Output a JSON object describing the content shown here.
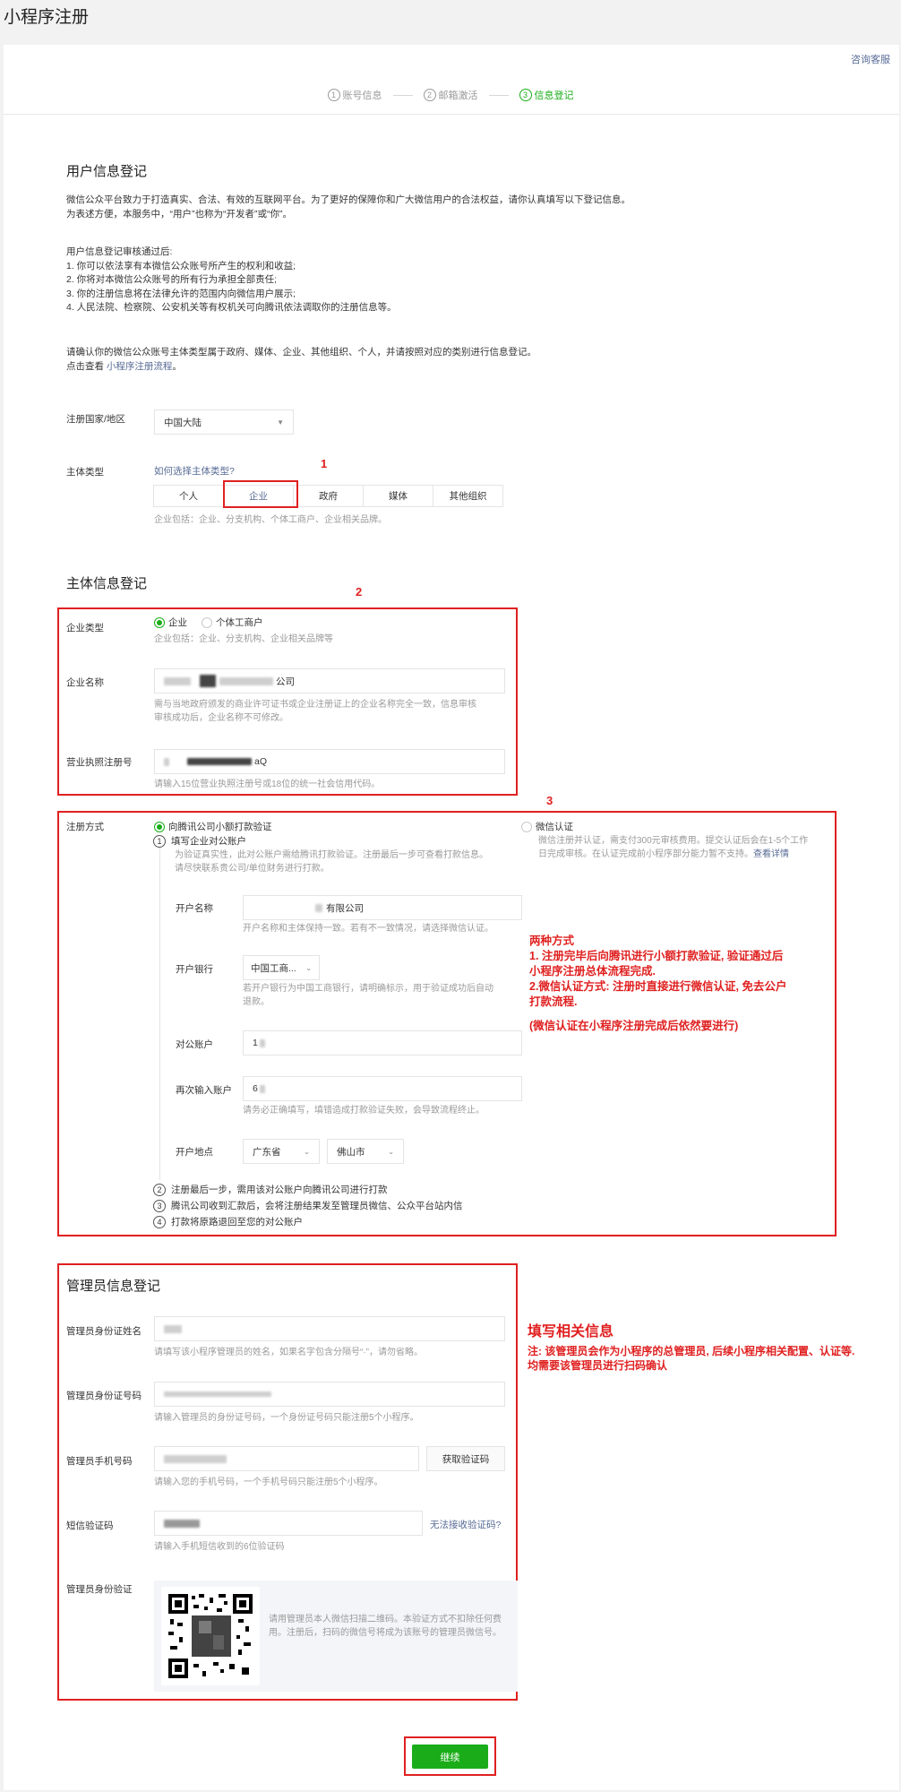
{
  "page": {
    "title": "小程序注册",
    "help": "咨询客服"
  },
  "steps": [
    {
      "num": "1",
      "label": "账号信息"
    },
    {
      "num": "2",
      "label": "邮箱激活"
    },
    {
      "num": "3",
      "label": "信息登记"
    }
  ],
  "user_info": {
    "title": "用户信息登记",
    "intro1": "微信公众平台致力于打造真实、合法、有效的互联网平台。为了更好的保障你和广大微信用户的合法权益，请你认真填写以下登记信息。",
    "intro2": "为表述方便，本服务中，“用户”也称为“开发者”或“你”。",
    "list_head": "用户信息登记审核通过后:",
    "list": [
      "1. 你可以依法享有本微信公众账号所产生的权利和收益;",
      "2. 你将对本微信公众账号的所有行为承担全部责任;",
      "3. 你的注册信息将在法律允许的范围内向微信用户展示;",
      "4. 人民法院、检察院、公安机关等有权机关可向腾讯依法调取你的注册信息等。"
    ],
    "confirm": "请确认你的微信公众账号主体类型属于政府、媒体、企业、其他组织、个人，并请按照对应的类别进行信息登记。",
    "view_prefix": "点击查看",
    "view_link": "小程序注册流程",
    "view_suffix": "。",
    "region_label": "注册国家/地区",
    "region_value": "中国大陆",
    "subject_label": "主体类型",
    "subject_help": "如何选择主体类型?",
    "subject_types": [
      "个人",
      "企业",
      "政府",
      "媒体",
      "其他组织"
    ],
    "subject_hint": "企业包括：企业、分支机构、个体工商户、企业相关品牌。"
  },
  "entity": {
    "title": "主体信息登记",
    "type_label": "企业类型",
    "type_options": [
      "企业",
      "个体工商户"
    ],
    "type_hint": "企业包括：企业、分支机构、企业相关品牌等",
    "name_label": "企业名称",
    "name_value": "公司",
    "name_hint1": "需与当地政府颁发的商业许可证书或企业注册证上的企业名称完全一致，信息审核",
    "name_hint2": "审核成功后，企业名称不可修改。",
    "license_label": "营业执照注册号",
    "license_value": "aQ",
    "license_hint": "请输入15位营业执照注册号或18位的统一社会信用代码。"
  },
  "register": {
    "label": "注册方式",
    "opt1": "向腾讯公司小额打款验证",
    "opt2": "微信认证",
    "opt2_hint1": "微信注册并认证，需支付300元审核费用。提交认证后会在1-5个工作",
    "opt2_hint2": "日完成审核。在认证完成前小程序部分能力暂不支持。",
    "opt2_link": "查看详情",
    "step1": "填写企业对公账户",
    "step1_hint1": "为验证真实性，此对公账户需给腾讯打款验证。注册最后一步可查看打款信息。",
    "step1_hint2": "请尽快联系贵公司/单位财务进行打款。",
    "acct_name_label": "开户名称",
    "acct_name_value": "有限公司",
    "acct_name_hint": "开户名称和主体保持一致。若有不一致情况，请选择微信认证。",
    "bank_label": "开户银行",
    "bank_value": "中国工商...",
    "bank_hint1": "若开户银行为中国工商银行，请明确标示，用于验证成功后自动",
    "bank_hint2": "退款。",
    "account_label": "对公账户",
    "account_value": "1",
    "account2_label": "再次输入账户",
    "account2_value": "6",
    "account_hint": "请务必正确填写，填错造成打款验证失败，会导致流程终止。",
    "location_label": "开户地点",
    "province": "广东省",
    "city": "佛山市",
    "steps_after": [
      {
        "num": "2",
        "text": "注册最后一步，需用该对公账户向腾讯公司进行打款"
      },
      {
        "num": "3",
        "text": "腾讯公司收到汇款后，会将注册结果发至管理员微信、公众平台站内信"
      },
      {
        "num": "4",
        "text": "打款将原路退回至您的对公账户"
      }
    ]
  },
  "admin": {
    "title": "管理员信息登记",
    "name_label": "管理员身份证姓名",
    "name_hint": "请填写该小程序管理员的姓名，如果名字包含分隔号“·”，请勿省略。",
    "id_label": "管理员身份证号码",
    "id_hint": "请输入管理员的身份证号码，一个身份证号码只能注册5个小程序。",
    "phone_label": "管理员手机号码",
    "phone_button": "获取验证码",
    "phone_hint": "请输入您的手机号码，一个手机号码只能注册5个小程序。",
    "sms_label": "短信验证码",
    "sms_link": "无法接收验证码?",
    "sms_hint": "请输入手机短信收到的6位验证码",
    "verify_label": "管理员身份验证",
    "verify_hint": "请用管理员本人微信扫描二维码。本验证方式不扣除任何费用。注册后，扫码的微信号将成为该账号的管理员微信号。"
  },
  "continue_button": "继续",
  "annotations": {
    "n1": "1",
    "n2": "2",
    "n3": "3",
    "methods_title": "两种方式",
    "methods_1a": "1. 注册完毕后向腾讯进行小额打款验证, 验证通过后",
    "methods_1b": "小程序注册总体流程完成.",
    "methods_2a": "2.微信认证方式: 注册时直接进行微信认证, 免去公户",
    "methods_2b": "打款流程.",
    "methods_note": "(微信认证在小程序注册完成后依然要进行)",
    "fill_title": "填写相关信息",
    "fill_note1": "注: 该管理员会作为小程序的总管理员, 后续小程序相关配置、认证等.",
    "fill_note2": "均需要该管理员进行扫码确认"
  },
  "colors": {
    "accent": "#1aad19",
    "link": "#576b95",
    "annotation": "#e02020"
  }
}
